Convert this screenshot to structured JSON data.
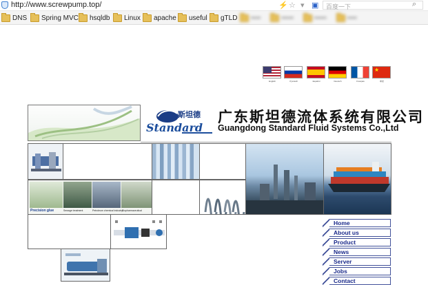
{
  "browser": {
    "url": "http://www.screwpump.top/",
    "search_placeholder": "百度一下"
  },
  "bookmarks": [
    {
      "label": "DNS"
    },
    {
      "label": "Spring MVC"
    },
    {
      "label": "hsqldb"
    },
    {
      "label": "Linux"
    },
    {
      "label": "apache"
    },
    {
      "label": "useful"
    },
    {
      "label": "gTLD"
    }
  ],
  "languages": [
    {
      "label": "English",
      "colors": [
        "#b22234",
        "#ffffff",
        "#3c3b6e"
      ]
    },
    {
      "label": "Русский",
      "colors": [
        "#ffffff",
        "#0039a6",
        "#d52b1e"
      ]
    },
    {
      "label": "Español",
      "colors": [
        "#c60b1e",
        "#ffc400",
        "#c60b1e"
      ]
    },
    {
      "label": "Deutsch",
      "colors": [
        "#000000",
        "#dd0000",
        "#ffce00"
      ]
    },
    {
      "label": "Français",
      "colors": [
        "#0055a4",
        "#ffffff",
        "#ef4135"
      ]
    },
    {
      "label": "中文",
      "colors": [
        "#de2910",
        "#de2910",
        "#de2910"
      ]
    }
  ],
  "header": {
    "company_cn": "广东斯坦德流体系统有限公司",
    "company_en": "Guangdong Standard Fluid Systems Co.,Ltd",
    "brand": "Standard",
    "brand_cn": "斯坦德"
  },
  "applications": [
    {
      "label": "Precision glue"
    },
    {
      "label": "Sewage treatment"
    },
    {
      "label": "Petroleum chemical industry"
    },
    {
      "label": "Biopharmaceutical"
    }
  ],
  "nav": [
    {
      "label": "Home"
    },
    {
      "label": "About us"
    },
    {
      "label": "Product"
    },
    {
      "label": "News"
    },
    {
      "label": "Server"
    },
    {
      "label": "Jobs"
    },
    {
      "label": "Contact"
    }
  ]
}
